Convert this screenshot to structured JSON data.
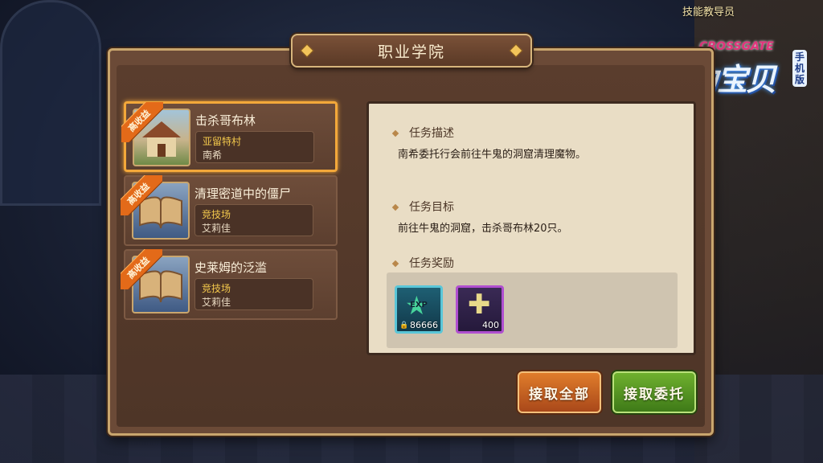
{
  "npc_label": "技能教导员",
  "logo": {
    "title": "魔力宝贝",
    "subtitle": "CROSSGATE",
    "edition": "手机版"
  },
  "panel": {
    "title": "职业学院"
  },
  "quests": [
    {
      "badge": "高收益",
      "name": "击杀哥布林",
      "location": "亚留特村",
      "npc": "南希",
      "thumb_icon": "house-icon",
      "selected": true
    },
    {
      "badge": "高收益",
      "name": "清理密道中的僵尸",
      "location": "竞技场",
      "npc": "艾莉佳",
      "thumb_icon": "book-icon",
      "selected": false
    },
    {
      "badge": "高收益",
      "name": "史莱姆的泛滥",
      "location": "竞技场",
      "npc": "艾莉佳",
      "thumb_icon": "book-icon",
      "selected": false
    }
  ],
  "detail": {
    "description_heading": "任务描述",
    "description": "南希委托行会前往牛鬼的洞窟清理魔物。",
    "objective_heading": "任务目标",
    "objective": "前往牛鬼的洞窟，击杀哥布林20只。",
    "reward_heading": "任务奖励",
    "rewards": [
      {
        "icon": "exp-star-icon",
        "label": "EXP",
        "quantity": "86666",
        "locked": true
      },
      {
        "icon": "cross-item-icon",
        "quantity": "400",
        "locked": false
      }
    ]
  },
  "buttons": {
    "accept_all": "接取全部",
    "accept": "接取委托"
  },
  "colors": {
    "selected_border": "#f3a83a",
    "badge": "#e36a19",
    "accept_all": "#e07d2b",
    "accept": "#6fb02e"
  }
}
